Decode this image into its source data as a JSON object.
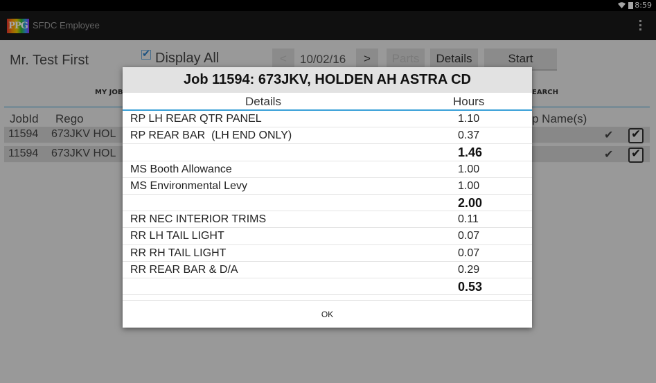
{
  "status": {
    "time": "8:59",
    "wifi_icon": "wifi-icon",
    "battery_icon": "battery-icon"
  },
  "appbar": {
    "logo": "PPG",
    "title": "SFDC Employee",
    "menu_icon": "overflow-menu-icon"
  },
  "header": {
    "employee_name": "Mr. Test  First",
    "display_all_label": "Display All",
    "display_all_checked": true,
    "prev_label": "<",
    "date": "10/02/16",
    "next_label": ">",
    "parts_label": "Parts",
    "details_label": "Details",
    "start_label": "Start"
  },
  "tabs": {
    "my_jobs_partial": "MY JOB",
    "search_partial": "EARCH"
  },
  "list": {
    "col_jobid": "JobId",
    "col_rego": "Rego",
    "col_names_partial": "p Name(s)",
    "rows": [
      {
        "jobid": "11594",
        "rego_partial": "673JKV  HOL",
        "checked": true
      },
      {
        "jobid": "11594",
        "rego_partial": "673JKV  HOL",
        "checked": true
      }
    ]
  },
  "dialog": {
    "title": "Job 11594: 673JKV, HOLDEN AH  ASTRA CD",
    "col_details": "Details",
    "col_hours": "Hours",
    "rows": [
      {
        "detail": "RP LH REAR QTR PANEL",
        "hours": "1.10",
        "total": false
      },
      {
        "detail": "RP REAR BAR  (LH END ONLY)",
        "hours": "0.37",
        "total": false
      },
      {
        "detail": "",
        "hours": "1.46",
        "total": true
      },
      {
        "detail": "MS Booth Allowance",
        "hours": "1.00",
        "total": false
      },
      {
        "detail": "MS Environmental Levy",
        "hours": "1.00",
        "total": false
      },
      {
        "detail": "",
        "hours": "2.00",
        "total": true
      },
      {
        "detail": "RR NEC INTERIOR TRIMS",
        "hours": "0.11",
        "total": false
      },
      {
        "detail": "RR LH TAIL LIGHT",
        "hours": "0.07",
        "total": false
      },
      {
        "detail": "RR RH TAIL LIGHT",
        "hours": "0.07",
        "total": false
      },
      {
        "detail": "RR REAR BAR & D/A",
        "hours": "0.29",
        "total": false
      },
      {
        "detail": "",
        "hours": "0.53",
        "total": true
      }
    ],
    "ok_label": "OK"
  },
  "colors": {
    "accent": "#3aa1d8",
    "actionbar": "#1a1a1a",
    "dialog_title_bg": "#e2e2e2"
  }
}
